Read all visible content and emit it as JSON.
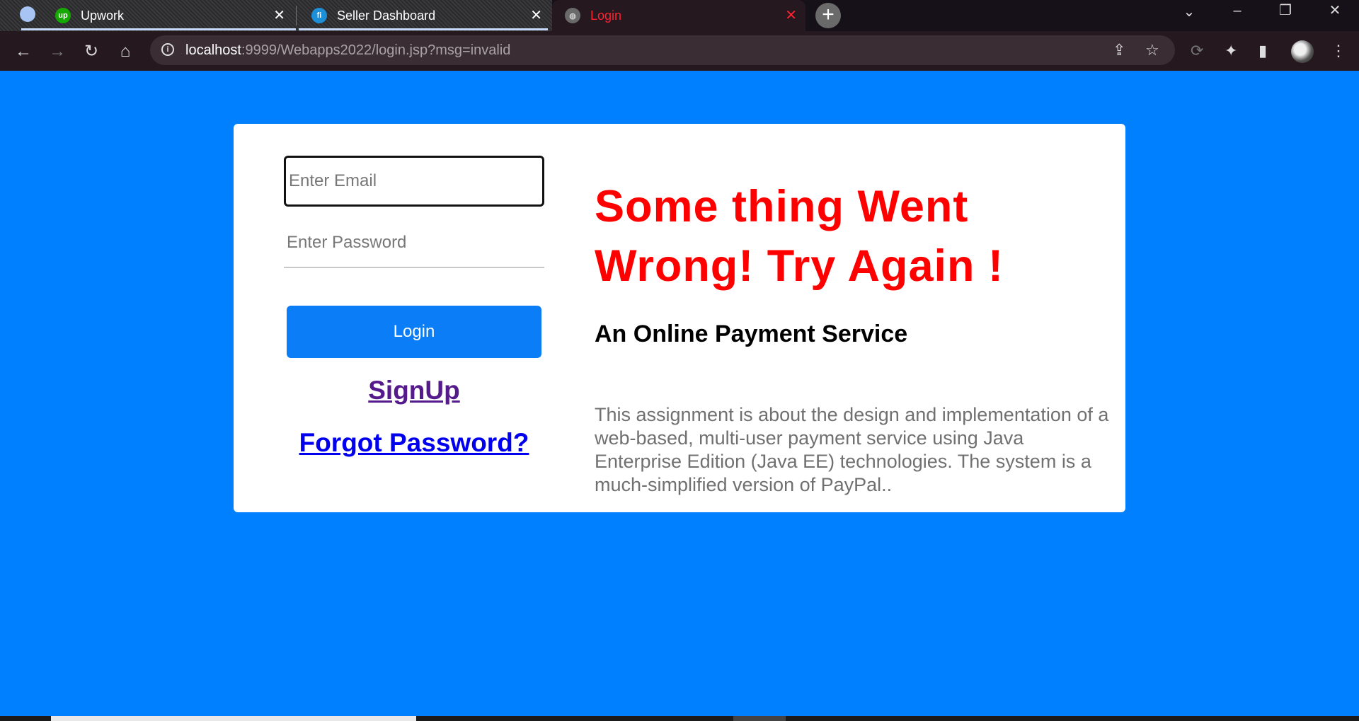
{
  "browser": {
    "tabs": [
      {
        "title": "Upwork",
        "favicon": "upwork-icon",
        "close": "✕"
      },
      {
        "title": "Seller Dashboard",
        "favicon": "seller-icon",
        "close": "✕"
      },
      {
        "title": "Login",
        "favicon": "globe-icon",
        "close": "✕",
        "active": true
      }
    ],
    "new_tab_glyph": "+",
    "url_host": "localhost",
    "url_rest": ":9999/Webapps2022/login.jsp?msg=invalid",
    "colors": {
      "active_tab_text": "#ff2030",
      "page_background": "#007fff"
    }
  },
  "login": {
    "email_placeholder": "Enter Email",
    "password_placeholder": "Enter Password",
    "login_label": "Login",
    "signup_label": "SignUp",
    "forgot_label": "Forgot Password?"
  },
  "info": {
    "error_message": "Some thing Went Wrong! Try Again !",
    "subtitle": "An Online Payment Service",
    "description": "This assignment is about the design and implementation of a web-based, multi-user payment service using Java Enterprise Edition (Java EE) technologies. The system is a much-simplified version of PayPal.."
  },
  "colors": {
    "primary_button": "#0b7df7",
    "error": "#ff0000",
    "visited_link": "#551a8b",
    "link": "#0000ee"
  }
}
